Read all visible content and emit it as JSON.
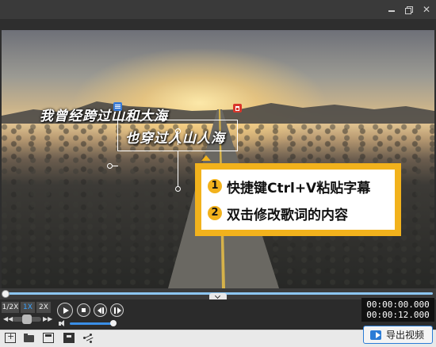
{
  "colors": {
    "accent": "#2b7cd6",
    "tip_border": "#f2b21c",
    "timeline": "#8cc6f2",
    "active_speed": "#3aa3ff"
  },
  "window": {
    "icons": [
      "minimize-icon",
      "restore-icon",
      "close-icon"
    ],
    "close_glyph": "✕"
  },
  "preview": {
    "lyric_line_1": "我曾经跨过山和大海",
    "lyric_line_2": "也穿过人山人海"
  },
  "tip": {
    "items": [
      {
        "num": "1",
        "text": "快捷键Ctrl+V粘贴字幕"
      },
      {
        "num": "2",
        "text": "双击修改歌词的内容"
      }
    ]
  },
  "playback": {
    "speeds": [
      "1/2X",
      "1X",
      "2X"
    ],
    "selected_speed": "1X",
    "rewind_glyph": "◀◀",
    "ffwd_glyph": "▶▶",
    "current_time": "00:00:00.000",
    "total_time": "00:00:12.000",
    "progress": 0.0,
    "volume": 0.95
  },
  "toolbar": {
    "icons": [
      "new-project-icon",
      "open-folder-icon",
      "save-icon",
      "save-as-icon",
      "share-icon"
    ],
    "export_label": "导出视频"
  }
}
